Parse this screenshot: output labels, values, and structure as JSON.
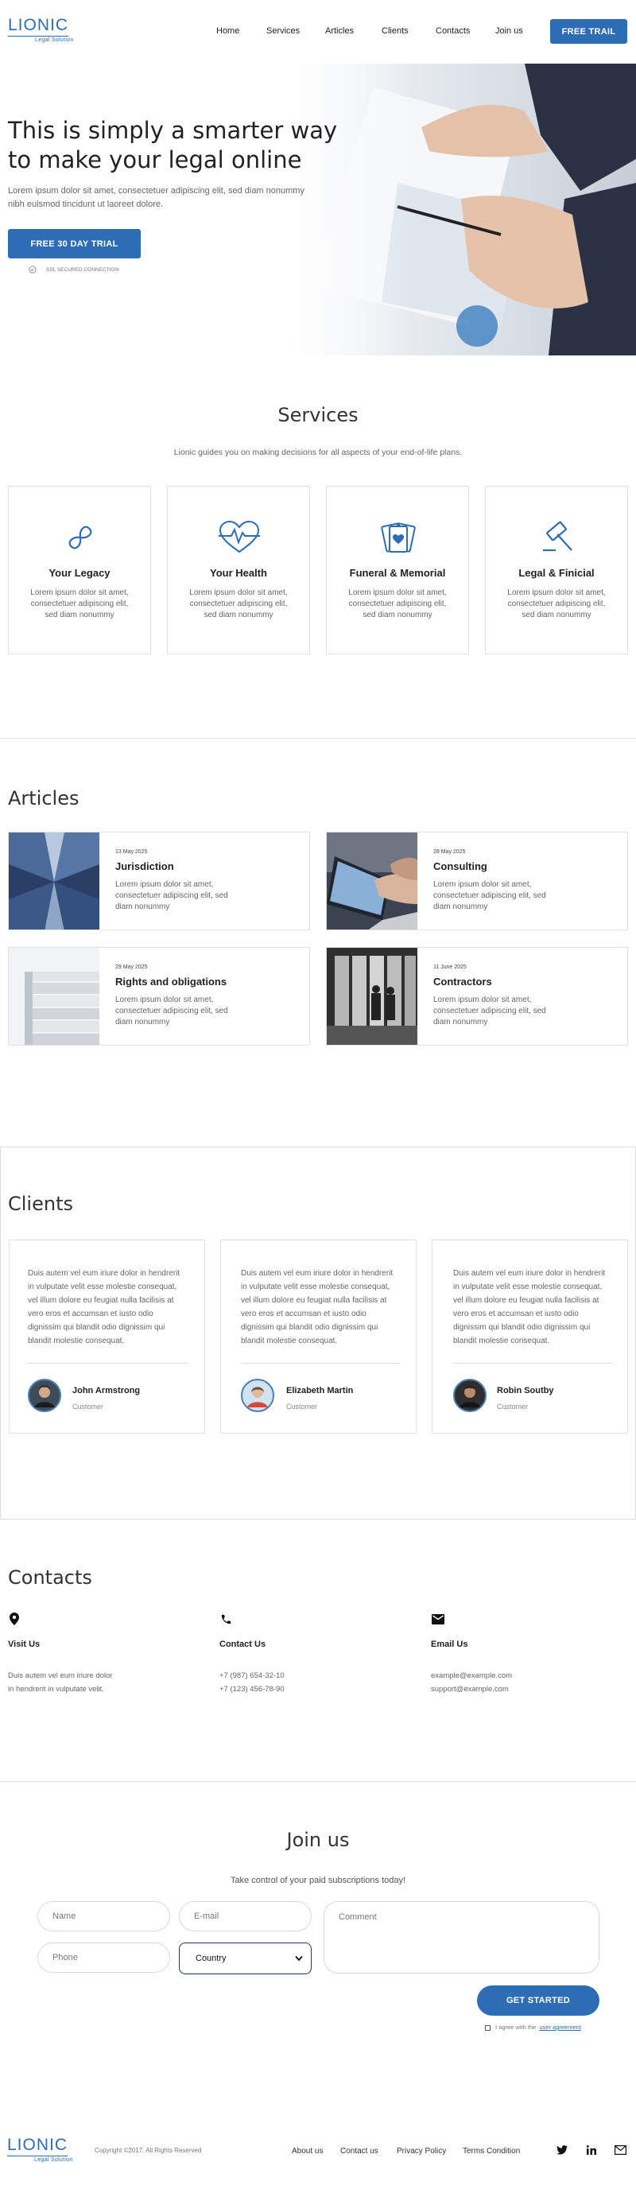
{
  "brand": {
    "name": "LIONIC",
    "tagline": "Legal Solution",
    "color": "#2d6db6"
  },
  "nav": {
    "items": [
      "Home",
      "Services",
      "Articles",
      "Clients",
      "Contacts",
      "Join us"
    ],
    "cta": "FREE TRAIL"
  },
  "hero": {
    "title_line1": "This is simply a smarter way",
    "title_line2": "to make your legal online",
    "text": "Lorem ipsum dolor sit amet, consectetuer adipiscing elit, sed diam nonummy nibh euismod tincidunt ut laoreet dolore.",
    "cta": "FREE 30 DAY TRIAL",
    "secure": "SSL SECURED CONNECTION"
  },
  "services": {
    "title": "Services",
    "subtitle": "Lionic guides you on making decisions for all aspects of your end-of-life plans.",
    "items": [
      {
        "name": "Your Legacy",
        "icon": "infinity-icon",
        "desc1": "Lorem ipsum dolor sit amet,",
        "desc2": "consectetuer adipiscing elit,",
        "desc3": "sed diam nonummy"
      },
      {
        "name": "Your Health",
        "icon": "heartbeat-icon",
        "desc1": "Lorem ipsum dolor sit amet,",
        "desc2": "consectetuer adipiscing elit,",
        "desc3": "sed diam nonummy"
      },
      {
        "name": "Funeral & Memorial",
        "icon": "memorial-cards-icon",
        "desc1": "Lorem ipsum dolor sit amet,",
        "desc2": "consectetuer adipiscing elit,",
        "desc3": "sed diam nonummy"
      },
      {
        "name": "Legal & Finicial",
        "icon": "gavel-icon",
        "desc1": "Lorem ipsum dolor sit amet,",
        "desc2": "consectetuer adipiscing elit,",
        "desc3": "sed diam nonummy"
      }
    ]
  },
  "articles": {
    "title": "Articles",
    "items": [
      {
        "date": "13 May 2025",
        "title": "Jurisdiction",
        "desc1": "Lorem ipsum dolor sit amet,",
        "desc2": "consectetuer adipiscing elit, sed",
        "desc3": "diam nonummy",
        "image": "skyscraper-photo"
      },
      {
        "date": "28 May 2025",
        "title": "Consulting",
        "desc1": "Lorem ipsum dolor sit amet,",
        "desc2": "consectetuer adipiscing elit, sed",
        "desc3": "diam nonummy",
        "image": "laptop-photo"
      },
      {
        "date": "29 May 2025",
        "title": "Rights and obligations",
        "desc1": "Lorem ipsum dolor sit amet,",
        "desc2": "consectetuer adipiscing elit, sed",
        "desc3": "diam nonummy",
        "image": "documents-photo"
      },
      {
        "date": "11 June 2025",
        "title": "Contractors",
        "desc1": "Lorem ipsum dolor sit amet,",
        "desc2": "consectetuer adipiscing elit, sed",
        "desc3": "diam nonummy",
        "image": "office-people-photo"
      }
    ]
  },
  "clients": {
    "title": "Clients",
    "items": [
      {
        "lines": [
          "Duis autem vel eum iriure dolor in hendrerit",
          "in vulputate velit esse molestie consequat,",
          "vel illum dolore eu feugiat nulla facilisis at",
          "vero eros et accumsan et iusto odio",
          "dignissim qui blandit odio dignissim qui",
          "blandit molestie consequat."
        ],
        "name": "John Armstrong",
        "role": "Customer"
      },
      {
        "lines": [
          "Duis autem vel eum iriure dolor in hendrerit",
          "in vulputate velit esse molestie consequat,",
          "vel illum dolore eu feugiat nulla facilisis at",
          "vero eros et accumsan et iusto odio",
          "dignissim qui blandit odio dignissim qui",
          "blandit molestie consequat."
        ],
        "name": "Elizabeth Martin",
        "role": "Customer"
      },
      {
        "lines": [
          "Duis autem vel eum iriure dolor in hendrerit",
          "in vulputate velit esse molestie consequat,",
          "vel illum dolore eu feugiat nulla facilisis at",
          "vero eros et accumsan et iusto odio",
          "dignissim qui blandit odio dignissim qui",
          "blandit molestie consequat."
        ],
        "name": "Robin Soutby",
        "role": "Customer"
      }
    ]
  },
  "contacts": {
    "title": "Contacts",
    "visit": {
      "head": "Visit Us",
      "line1": "Duis autem vel eum iriure dolor",
      "line2": "in hendrerit in vulputate velit."
    },
    "contact": {
      "head": "Contact Us",
      "line1": "+7 (987) 654-32-10",
      "line2": "+7 (123) 456-78-90"
    },
    "email": {
      "head": "Email Us",
      "line1": "example@example.com",
      "line2": "support@example.com"
    }
  },
  "join": {
    "title": "Join us",
    "subtitle": "Take control of your paid subscriptions today!",
    "name_placeholder": "Name",
    "email_placeholder": "E-mail",
    "phone_placeholder": "Phone",
    "country_value": "Country",
    "comment_placeholder": "Comment",
    "cta": "GET STARTED",
    "agree_text": "I agree with the",
    "agree_link": "user agreement"
  },
  "footer": {
    "copyright": "Copyright ©2017. All Rights Reserved",
    "links": [
      "About us",
      "Contact us",
      "Privacy Policy",
      "Terms Condition"
    ],
    "social": [
      "twitter-icon",
      "linkedin-icon",
      "mail-icon"
    ]
  }
}
